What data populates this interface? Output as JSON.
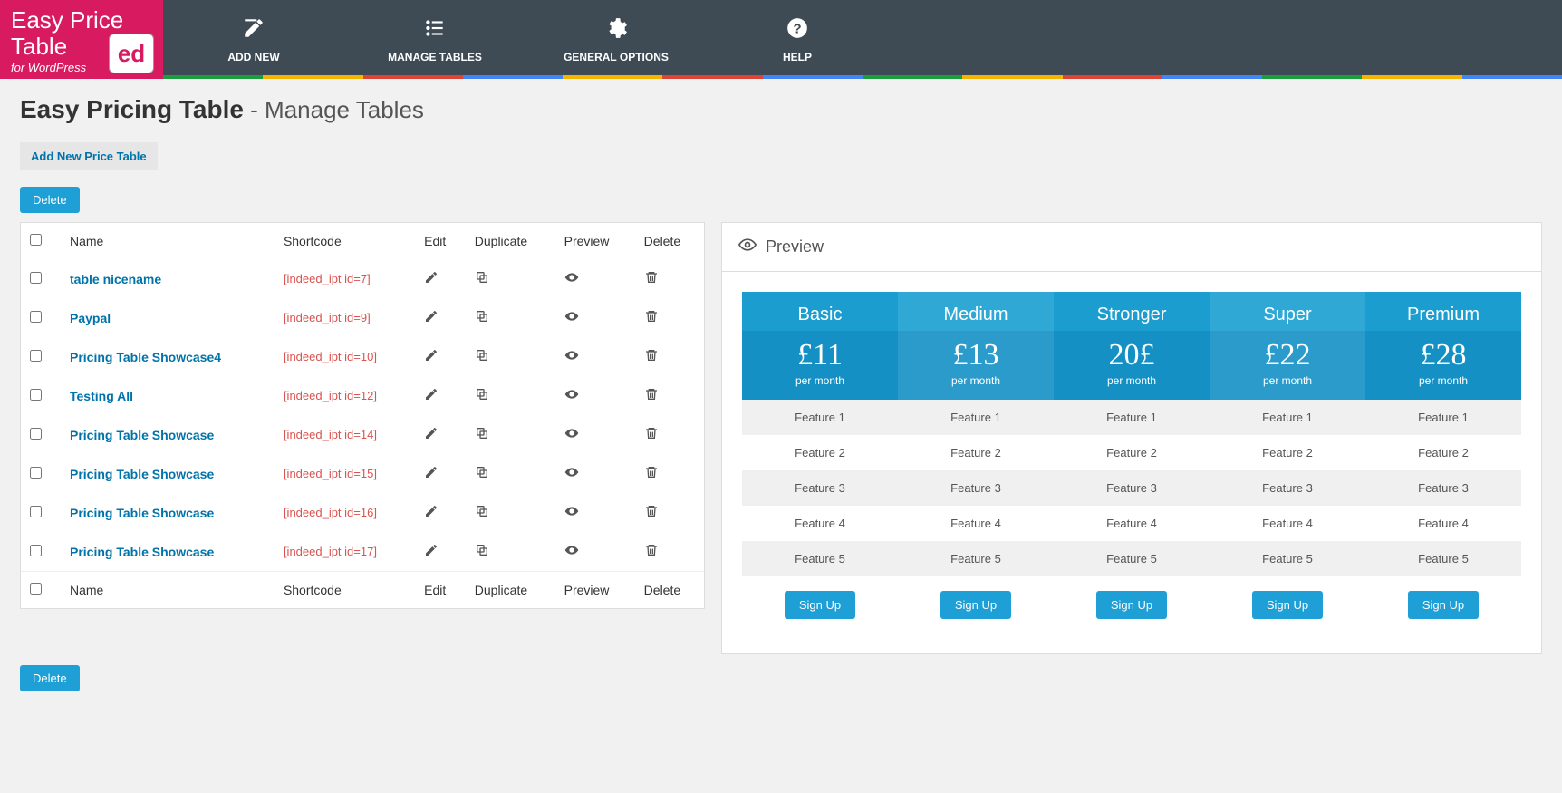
{
  "logo": {
    "line1": "Easy Price",
    "line2": "Table",
    "sub": "for WordPress",
    "badge": "ed"
  },
  "nav": {
    "add_new": "ADD NEW",
    "manage": "MANAGE TABLES",
    "general": "GENERAL OPTIONS",
    "help": "HELP"
  },
  "stripe_colors": [
    "#1b9e3f",
    "#f4b400",
    "#db4437",
    "#4285f4",
    "#f4b400",
    "#db4437",
    "#4285f4",
    "#1b9e3f",
    "#f4b400",
    "#db4437",
    "#4285f4",
    "#1b9e3f",
    "#f4b400",
    "#4285f4"
  ],
  "page_title_bold": "Easy Pricing Table",
  "page_title_sep": " - ",
  "page_title_thin": "Manage Tables",
  "add_new_btn": "Add New Price Table",
  "delete_btn": "Delete",
  "columns": {
    "name": "Name",
    "shortcode": "Shortcode",
    "edit": "Edit",
    "duplicate": "Duplicate",
    "preview": "Preview",
    "delete": "Delete"
  },
  "rows": [
    {
      "name": "table nicename",
      "shortcode": "[indeed_ipt id=7]"
    },
    {
      "name": "Paypal",
      "shortcode": "[indeed_ipt id=9]"
    },
    {
      "name": "Pricing Table Showcase4",
      "shortcode": "[indeed_ipt id=10]"
    },
    {
      "name": "Testing All",
      "shortcode": "[indeed_ipt id=12]"
    },
    {
      "name": "Pricing Table Showcase",
      "shortcode": "[indeed_ipt id=14]"
    },
    {
      "name": "Pricing Table Showcase",
      "shortcode": "[indeed_ipt id=15]"
    },
    {
      "name": "Pricing Table Showcase",
      "shortcode": "[indeed_ipt id=16]"
    },
    {
      "name": "Pricing Table Showcase",
      "shortcode": "[indeed_ipt id=17]"
    }
  ],
  "preview_label": "Preview",
  "plans": [
    {
      "title": "Basic",
      "price": "£11",
      "sub": "per month"
    },
    {
      "title": "Medium",
      "price": "£13",
      "sub": "per month"
    },
    {
      "title": "Stronger",
      "price": "20£",
      "sub": "per month"
    },
    {
      "title": "Super",
      "price": "£22",
      "sub": "per month"
    },
    {
      "title": "Premium",
      "price": "£28",
      "sub": "per month"
    }
  ],
  "features": [
    "Feature 1",
    "Feature 2",
    "Feature 3",
    "Feature 4",
    "Feature 5"
  ],
  "signup": "Sign Up"
}
